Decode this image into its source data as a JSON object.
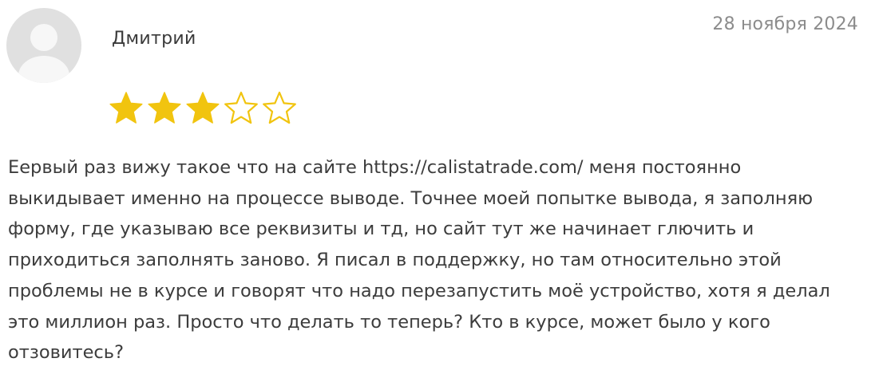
{
  "review": {
    "author": "Дмитрий",
    "date": "28 ноября 2024",
    "rating": 3,
    "rating_max": 5,
    "star_color": "#f1c40f",
    "star_empty_stroke": "#f1c40f",
    "text": "Еервый раз вижу такое что на сайте https://calistatrade.com/ меня постоянно выкидывает именно на процессе выводе. Точнее моей попытке вывода, я заполняю форму, где указываю все реквизиты и тд, но сайт тут же начинает глючить и приходиться заполнять заново. Я писал в поддержку, но там относительно этой проблемы не в курсе и говорят что надо перезапустить моё устройство, хотя я делал это миллион раз. Просто что делать то теперь? Кто в курсе, может было у кого отзовитесь?",
    "avatar_icon": "user-avatar-placeholder-icon"
  }
}
